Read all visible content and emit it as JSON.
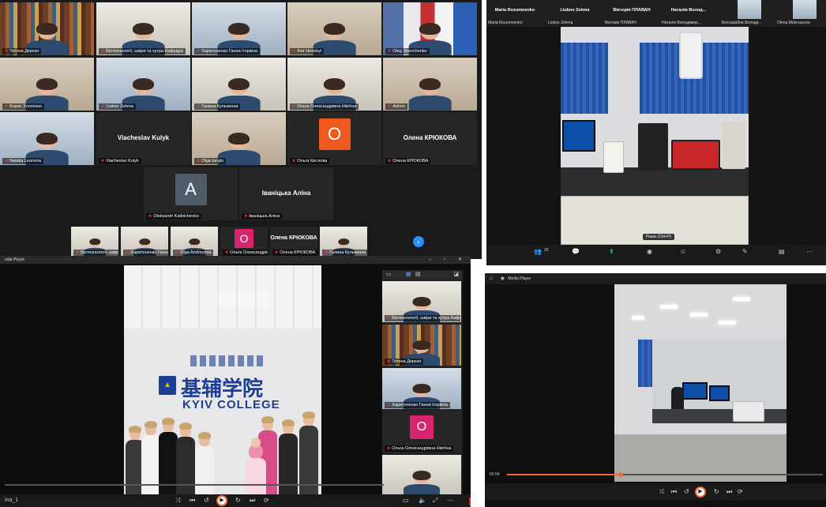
{
  "gallery": {
    "tiles": [
      {
        "id": "t1",
        "name": "Тетяна Деркач",
        "bg": "bookshelf",
        "active": true
      },
      {
        "id": "t2",
        "name": "Біотехнології, шкіри та хутра Кафедра",
        "bg": "wallpale"
      },
      {
        "id": "t3",
        "name": "Харитоненко Ганна Ігорівна",
        "bg": "wallcool"
      },
      {
        "id": "t4",
        "name": "Ihor Hretskyi",
        "bg": "wallwarm"
      },
      {
        "id": "t5",
        "name": "Oleg Shevchenko",
        "bg": "flags"
      },
      {
        "id": "t6",
        "name": "Борис Злотенко",
        "bg": "wallwarm"
      },
      {
        "id": "t7",
        "name": "Liubov Zelena",
        "bg": "wallcool"
      },
      {
        "id": "t8",
        "name": "Галина Кульчинна",
        "bg": "wallpale"
      },
      {
        "id": "t9",
        "name": "Ольга Олександрівна Нікітіна",
        "bg": "wallpale"
      },
      {
        "id": "t10",
        "name": "Admin",
        "bg": "wallwarm"
      },
      {
        "id": "t11",
        "name": "Natalia Leonova",
        "bg": "wallcool"
      },
      {
        "id": "t12",
        "name": "Viacheslav Kulyk",
        "display": "Viacheslav Kulyk"
      },
      {
        "id": "t13",
        "name": "Olga Iungin",
        "bg": "wallwarm"
      },
      {
        "id": "t14",
        "name": "Ольга Кислова",
        "avatar": "O",
        "color": "#f05a1e"
      },
      {
        "id": "t15",
        "name": "Олена КРЮКОВА",
        "display": "Олена КРЮКОВА"
      },
      {
        "id": "t16",
        "name": "Oleksandr Kalinichenko",
        "avatar": "A",
        "color": "#4f5d6b"
      },
      {
        "id": "t17",
        "name": "Іваніцька Аліна",
        "display": "Іваніцька Аліна"
      }
    ],
    "strip": [
      {
        "name": "Біотехнології, шкіри"
      },
      {
        "name": "Харитоненко Ганна І..."
      },
      {
        "name": "Olga Andreyeva"
      },
      {
        "name": "Ольга Олександрівн...",
        "avatar": "O",
        "color": "#d6246e"
      },
      {
        "name": "Олена КРЮКОВА",
        "display": "Олена КРЮКОВА"
      },
      {
        "name": "Галина Кульчинна"
      }
    ]
  },
  "shared_top": {
    "header_names": [
      {
        "display": "Maria Rozumnenko",
        "name": "Maria Rozumnenko"
      },
      {
        "display": "Liubov Zelena",
        "name": "Liubov Zelena"
      },
      {
        "display": "Вікторія ПЛАВАН",
        "name": "Вікторія ПЛАВАН"
      },
      {
        "display": "Наталія Волод...",
        "name": "Наталія Володимир..."
      },
      {
        "display": "",
        "name": "Бессарабов Володи..."
      },
      {
        "display": "",
        "name": "Olena Mokrousova"
      }
    ],
    "shortcut_tooltip": "Рiшок (Ctrl+P)",
    "tool_participants_count": "25"
  },
  "media_left": {
    "title": "Media Player",
    "title_visible": "edia Player",
    "filename": "ina_1",
    "college_cn": "基辅学院",
    "college_en": "KYIV COLLEGE",
    "side_participants": [
      {
        "name": "Біотехнології, шкіри та хутра Кафедра"
      },
      {
        "name": "Тетяна Деркач",
        "active": true
      },
      {
        "name": "Харитоненко Ганна Ігорівна"
      },
      {
        "name": "Ольга Олександрівна Нікітіна",
        "avatar": "O",
        "color": "#d6246e"
      },
      {
        "name": ""
      }
    ]
  },
  "media_right": {
    "title": "Media Player",
    "time": "00:04",
    "progress": 0.36
  },
  "colors": {
    "accent_orange": "#ef6b35",
    "zoom_blue": "#2d8cff",
    "active_yellow": "#f4d11b",
    "mic_red": "#e23b3b"
  }
}
